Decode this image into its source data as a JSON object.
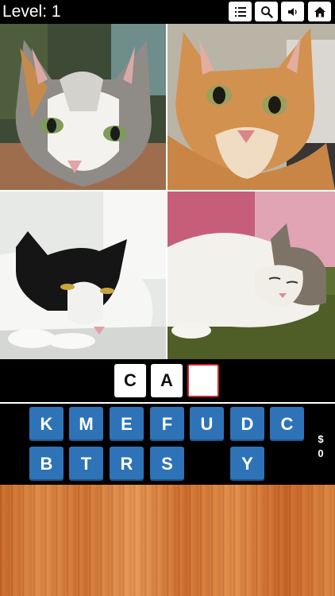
{
  "header": {
    "level_text": "Level: 1",
    "buttons": [
      {
        "name": "list-button",
        "icon": "list-icon"
      },
      {
        "name": "search-button",
        "icon": "magnifier-icon"
      },
      {
        "name": "sound-button",
        "icon": "speaker-icon"
      },
      {
        "name": "home-button",
        "icon": "home-icon"
      }
    ]
  },
  "photos": [
    {
      "subject": "calico cat face close-up"
    },
    {
      "subject": "orange tabby cat face close-up"
    },
    {
      "subject": "black and white cat lying down"
    },
    {
      "subject": "white and tabby cat sleeping on grass"
    }
  ],
  "answer": {
    "slots": [
      "C",
      "A",
      ""
    ],
    "active_slot": 2
  },
  "keyboard": {
    "row1": [
      "K",
      "M",
      "E",
      "F",
      "U",
      "D",
      "C"
    ],
    "row2": [
      "B",
      "T",
      "R",
      "S",
      "",
      "Y",
      ""
    ]
  },
  "coins": {
    "symbol": "$",
    "value": "0"
  },
  "colors": {
    "key_blue": "#2e73b8",
    "active_slot_border": "#d0262c",
    "wood": "#d9803e"
  }
}
